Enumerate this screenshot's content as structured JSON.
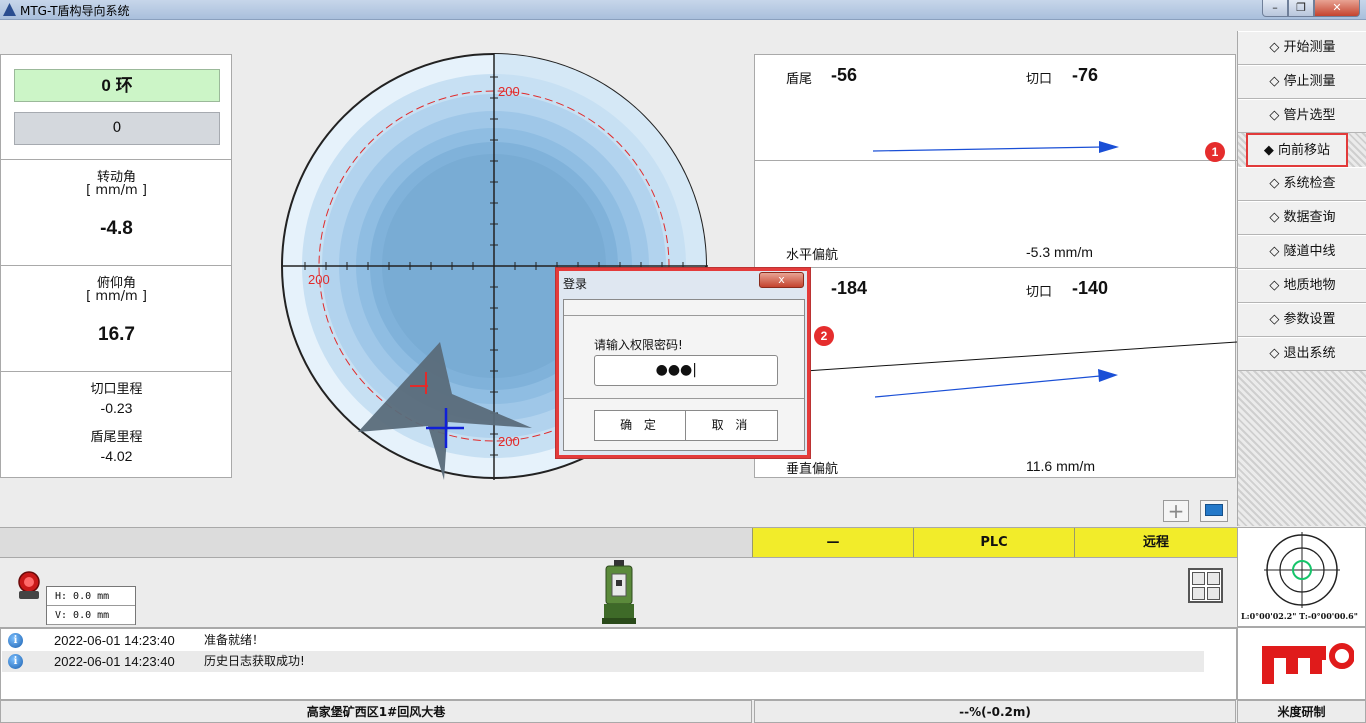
{
  "window": {
    "title": "MTG-T盾构导向系统",
    "min": "–",
    "max": "❐",
    "close": "✕"
  },
  "left": {
    "ring_value": "0 环",
    "ring_sub": "0",
    "rotation_label": "转动角",
    "rotation_unit": "[ mm/m ]",
    "rotation_value": "-4.8",
    "pitch_label": "俯仰角",
    "pitch_unit": "[ mm/m ]",
    "pitch_value": "16.7",
    "cut_mileage_label": "切口里程",
    "cut_mileage_value": "-0.23",
    "tail_mileage_label": "盾尾里程",
    "tail_mileage_value": "-4.02"
  },
  "target": {
    "label_top": "200",
    "label_left": "200",
    "label_bottom": "200",
    "label_right": "200"
  },
  "right": {
    "h_tail_label": "盾尾",
    "h_tail_value": "-56",
    "h_cut_label": "切口",
    "h_cut_value": "-76",
    "h_nav_label": "水平偏航",
    "h_nav_value": "-5.3 mm/m",
    "v_tail_value": "-184",
    "v_cut_label": "切口",
    "v_cut_value": "-140",
    "v_nav_label": "垂直偏航",
    "v_nav_value": "11.6 mm/m"
  },
  "menu": {
    "items": [
      "◇ 开始测量",
      "◇ 停止测量",
      "◇ 管片选型",
      "◆ 向前移站",
      "◇ 系统检查",
      "◇ 数据查询",
      "◇ 隧道中线",
      "◇ 地质地物",
      "◇ 参数设置",
      "◇ 退出系统"
    ]
  },
  "badges": {
    "one": "1",
    "two": "2"
  },
  "status_strip": {
    "cell1": "—",
    "cell2": "PLC",
    "cell3": "远程"
  },
  "instrument": {
    "h": "H: 0.0 mm",
    "v": "V: 0.0 mm",
    "plus": "+"
  },
  "laser": {
    "readout": "L:0°00'02.2\" T:-0°00'00.6\""
  },
  "log": [
    {
      "time": "2022-06-01 14:23:40",
      "msg": "准备就绪！"
    },
    {
      "time": "2022-06-01 14:23:40",
      "msg": "历史日志获取成功!"
    }
  ],
  "footer": {
    "location": "高家堡矿西区1#回风大巷",
    "progress": "--%(-0.2m)",
    "brand": "米度研制"
  },
  "dialog": {
    "title": "登录",
    "close": "x",
    "prompt": "请输入权限密码!",
    "password_mask": "●●●|",
    "ok": "确 定",
    "cancel": "取 消"
  },
  "colors": {
    "accent_red": "#e23a3a",
    "strip_yellow": "#f2ec2a",
    "ring_green": "#ccf5c7",
    "arrow_blue": "#1a4fd6"
  }
}
